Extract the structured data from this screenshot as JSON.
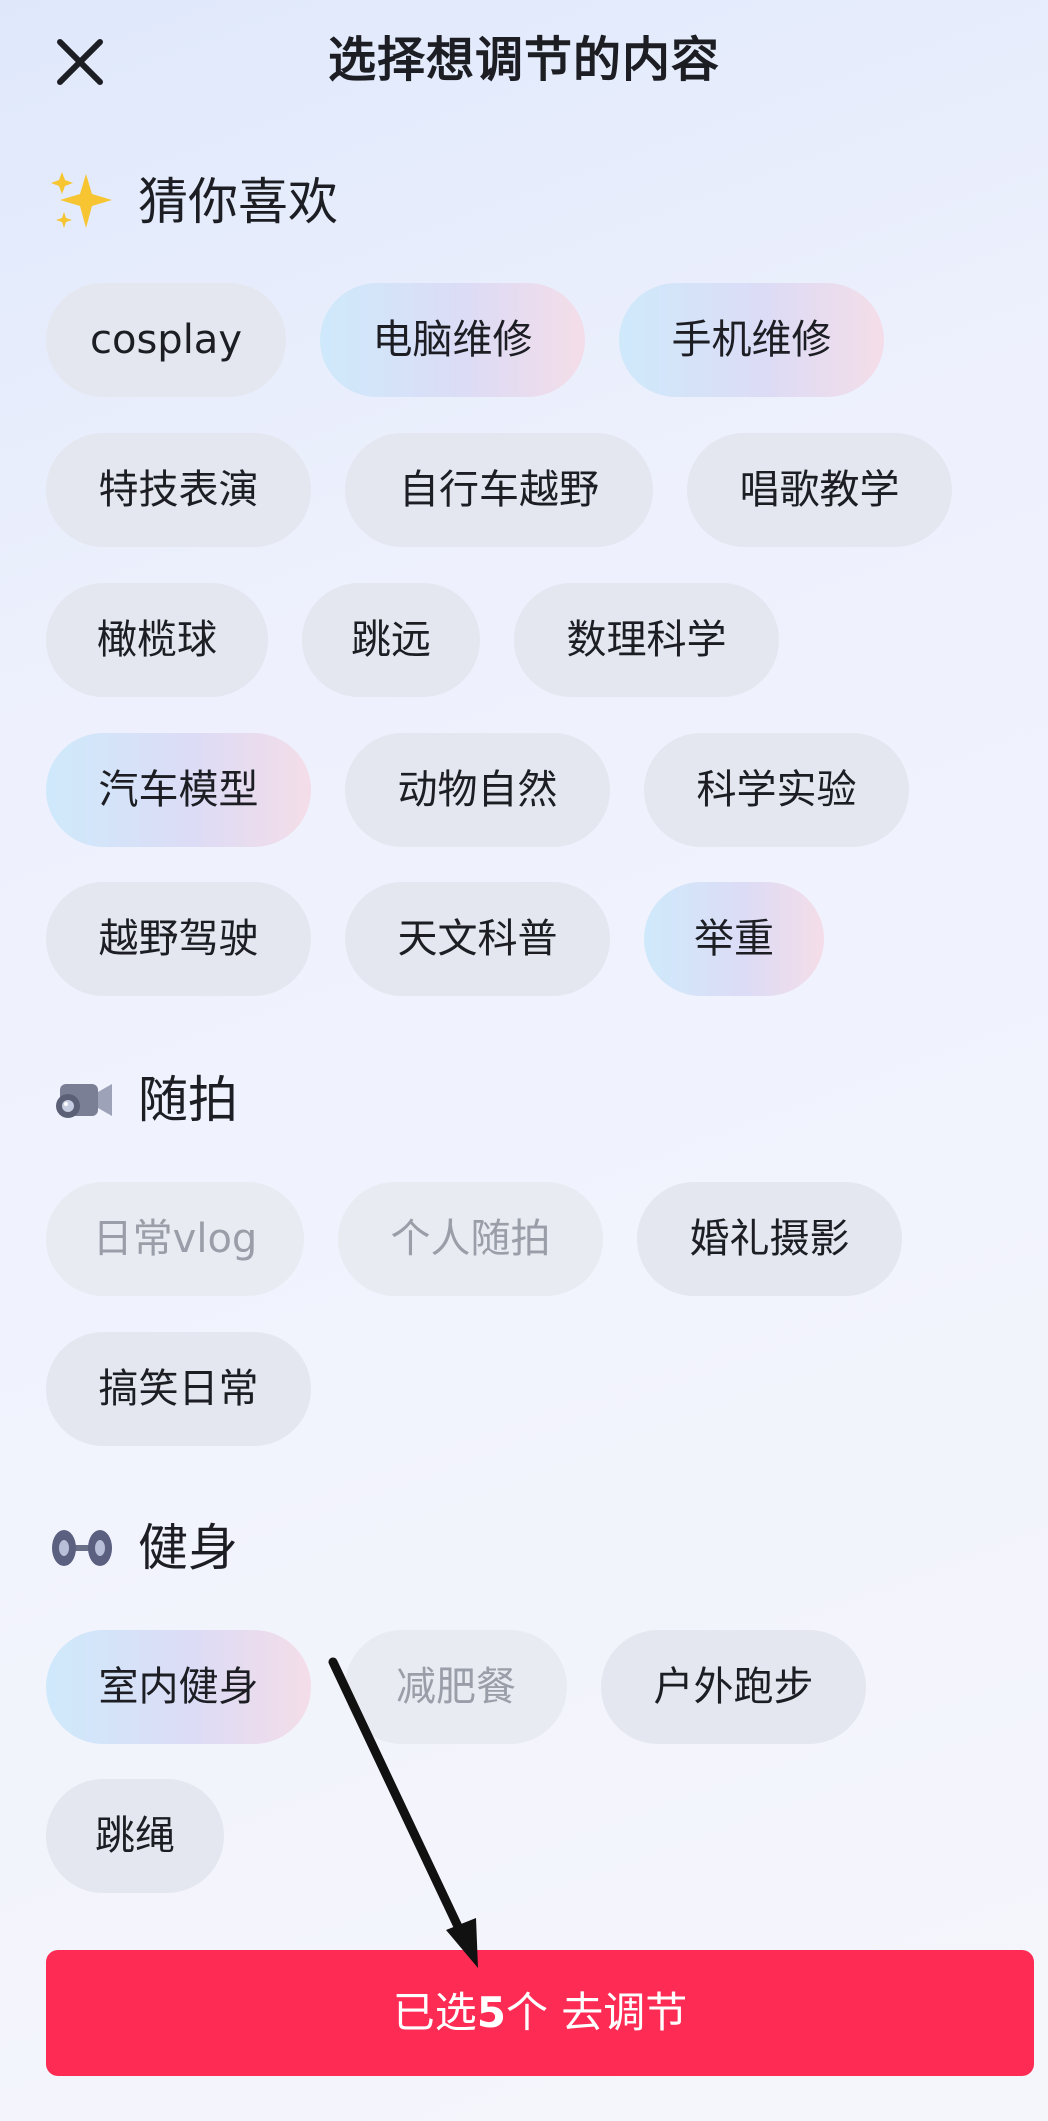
{
  "header": {
    "title": "选择想调节的内容"
  },
  "sections": [
    {
      "label": "猜你喜欢",
      "icon": "sparkles-icon",
      "chips": [
        {
          "label": "cosplay",
          "state": "normal"
        },
        {
          "label": "电脑维修",
          "state": "selected"
        },
        {
          "label": "手机维修",
          "state": "selected"
        },
        {
          "label": "特技表演",
          "state": "normal"
        },
        {
          "label": "自行车越野",
          "state": "normal"
        },
        {
          "label": "唱歌教学",
          "state": "normal"
        },
        {
          "label": "橄榄球",
          "state": "normal"
        },
        {
          "label": "跳远",
          "state": "normal"
        },
        {
          "label": "数理科学",
          "state": "normal"
        },
        {
          "label": "汽车模型",
          "state": "selected"
        },
        {
          "label": "动物自然",
          "state": "normal"
        },
        {
          "label": "科学实验",
          "state": "normal"
        },
        {
          "label": "越野驾驶",
          "state": "normal"
        },
        {
          "label": "天文科普",
          "state": "normal"
        },
        {
          "label": "举重",
          "state": "selected"
        }
      ]
    },
    {
      "label": "随拍",
      "icon": "video-camera-icon",
      "chips": [
        {
          "label": "日常vlog",
          "state": "disabled"
        },
        {
          "label": "个人随拍",
          "state": "disabled"
        },
        {
          "label": "婚礼摄影",
          "state": "normal"
        },
        {
          "label": "搞笑日常",
          "state": "normal"
        }
      ]
    },
    {
      "label": "健身",
      "icon": "dumbbell-icon",
      "chips": [
        {
          "label": "室内健身",
          "state": "selected"
        },
        {
          "label": "减肥餐",
          "state": "disabled"
        },
        {
          "label": "户外跑步",
          "state": "normal"
        },
        {
          "label": "跳绳",
          "state": "normal"
        }
      ]
    }
  ],
  "cta": {
    "prefix": "已选",
    "count": "5",
    "suffix": "个 去调节"
  },
  "colors": {
    "accent": "#fe2c55",
    "chip_bg": "#e4e7ef"
  }
}
